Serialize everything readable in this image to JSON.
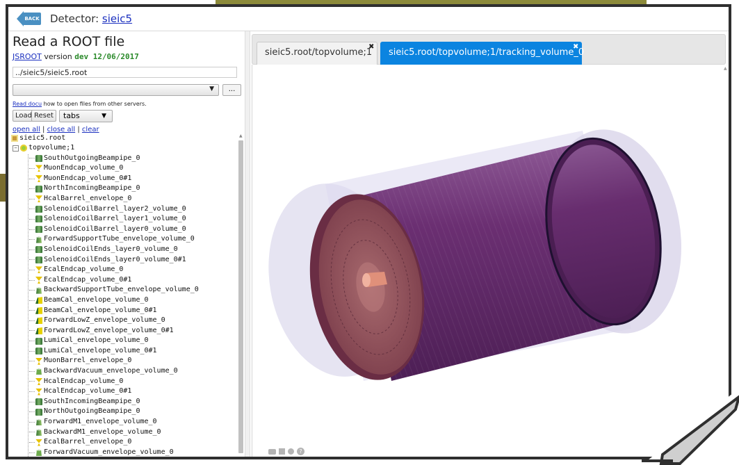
{
  "header": {
    "back_label": "BACK",
    "title_prefix": "Detector: ",
    "title_link": "sieic5"
  },
  "left": {
    "title": "Read a ROOT file",
    "version_link": "JSROOT",
    "version_text": " version ",
    "version_value": "dev 12/06/2017",
    "file_value": "../sieic5/sieic5.root",
    "select_value": "",
    "dots_label": "...",
    "readdocu_link": "Read docu",
    "readdocu_text": " how to open files from other servers.",
    "load_label": "Load",
    "reset_label": "Reset",
    "tabs_value": "tabs",
    "open_all": "open all",
    "close_all": "close all",
    "clear": "clear",
    "sep": " | "
  },
  "tree": {
    "root_label": "sieic5.root",
    "top_label": "topvolume;1",
    "items": [
      {
        "label": "SouthOutgoingBeampipe_0",
        "icon": "tube-icon"
      },
      {
        "label": "MuonEndcap_volume_0",
        "icon": "endcap-icon"
      },
      {
        "label": "MuonEndcap_volume_0#1",
        "icon": "endcap-icon"
      },
      {
        "label": "NorthIncomingBeampipe_0",
        "icon": "tube-icon"
      },
      {
        "label": "HcalBarrel_envelope_0",
        "icon": "endcap-icon"
      },
      {
        "label": "SolenoidCoilBarrel_layer2_volume_0",
        "icon": "tube-icon"
      },
      {
        "label": "SolenoidCoilBarrel_layer1_volume_0",
        "icon": "tube-icon"
      },
      {
        "label": "SolenoidCoilBarrel_layer0_volume_0",
        "icon": "tube-icon"
      },
      {
        "label": "ForwardSupportTube_envelope_volume_0",
        "icon": "envelope-icon"
      },
      {
        "label": "SolenoidCoilEnds_layer0_volume_0",
        "icon": "tube-icon"
      },
      {
        "label": "SolenoidCoilEnds_layer0_volume_0#1",
        "icon": "tube-icon"
      },
      {
        "label": "EcalEndcap_volume_0",
        "icon": "endcap-icon"
      },
      {
        "label": "EcalEndcap_volume_0#1",
        "icon": "endcap-icon"
      },
      {
        "label": "BackwardSupportTube_envelope_volume_0",
        "icon": "envelope-icon"
      },
      {
        "label": "BeamCal_envelope_volume_0",
        "icon": "cone-icon"
      },
      {
        "label": "BeamCal_envelope_volume_0#1",
        "icon": "cone-icon"
      },
      {
        "label": "ForwardLowZ_envelope_volume_0",
        "icon": "cone-icon"
      },
      {
        "label": "ForwardLowZ_envelope_volume_0#1",
        "icon": "cone-icon"
      },
      {
        "label": "LumiCal_envelope_volume_0",
        "icon": "tube-icon"
      },
      {
        "label": "LumiCal_envelope_volume_0#1",
        "icon": "tube-icon"
      },
      {
        "label": "MuonBarrel_envelope_0",
        "icon": "endcap-icon"
      },
      {
        "label": "BackwardVacuum_envelope_volume_0",
        "icon": "vacuum-icon"
      },
      {
        "label": "HcalEndcap_volume_0",
        "icon": "endcap-icon"
      },
      {
        "label": "HcalEndcap_volume_0#1",
        "icon": "endcap-icon"
      },
      {
        "label": "SouthIncomingBeampipe_0",
        "icon": "tube-icon"
      },
      {
        "label": "NorthOutgoingBeampipe_0",
        "icon": "tube-icon"
      },
      {
        "label": "ForwardM1_envelope_volume_0",
        "icon": "envelope-icon"
      },
      {
        "label": "BackwardM1_envelope_volume_0",
        "icon": "envelope-icon"
      },
      {
        "label": "EcalBarrel_envelope_0",
        "icon": "endcap-icon"
      },
      {
        "label": "ForwardVacuum_envelope_volume_0",
        "icon": "vacuum-icon"
      }
    ]
  },
  "tabs": [
    {
      "label": "sieic5.root/topvolume;1",
      "close": "✖",
      "active": false
    },
    {
      "label": "sieic5.root/topvolume;1/tracking_volume_0",
      "close": "✖",
      "active": true
    }
  ],
  "colors": {
    "active_tab": "#0b84e0",
    "link": "#1a2fbf",
    "version_green": "#2b8a2b",
    "detector_purple": "#6a2f6a",
    "detector_cap": "#9a4e5a"
  }
}
